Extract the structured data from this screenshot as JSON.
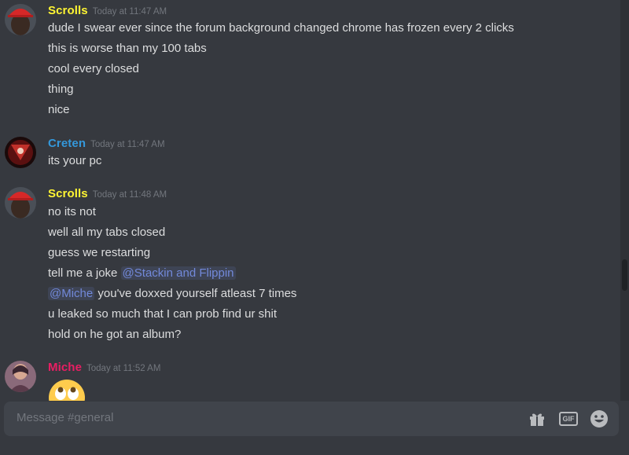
{
  "messages": [
    {
      "username": "Scrolls",
      "username_color": "#fff533",
      "timestamp": "Today at 11:47 AM",
      "lines": [
        "dude I swear ever since the forum background changed chrome has frozen every 2 clicks",
        "this is worse than my 100 tabs",
        "cool every closed",
        "thing",
        "nice"
      ]
    },
    {
      "username": "Creten",
      "username_color": "#3498db",
      "timestamp": "Today at 11:47 AM",
      "lines": [
        "its your pc"
      ]
    },
    {
      "username": "Scrolls",
      "username_color": "#fff533",
      "timestamp": "Today at 11:48 AM",
      "lines": [
        "no its not",
        "well all my tabs closed",
        "guess we restarting",
        "tell me a joke",
        "you've doxxed yourself atleast 7 times",
        "u leaked so much that I can prob find ur shit",
        "hold on he got an album?"
      ],
      "mentions": {
        "joke_mention": "@Stackin and Flippin",
        "doxx_mention": "@Miche"
      }
    },
    {
      "username": "Miche",
      "username_color": "#e91e63",
      "timestamp": "Today at 11:52 AM",
      "emoji": "rolling-eyes-emoji"
    }
  ],
  "composer": {
    "placeholder": "Message #general",
    "gif_label": "GIF",
    "icons": [
      "gift-icon",
      "gif-icon",
      "emoji-icon"
    ]
  }
}
